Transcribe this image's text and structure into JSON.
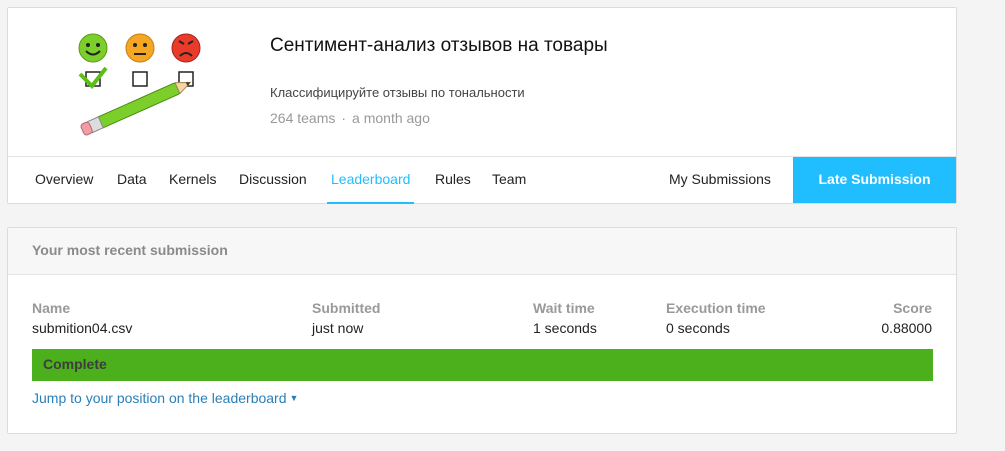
{
  "competition": {
    "title": "Сентимент-анализ отзывов на товары",
    "subtitle": "Классифицируйте отзывы по тональности",
    "teams": "264 teams",
    "separator": "·",
    "age": "a month ago"
  },
  "tabs": [
    {
      "label": "Overview",
      "active": false
    },
    {
      "label": "Data",
      "active": false
    },
    {
      "label": "Kernels",
      "active": false
    },
    {
      "label": "Discussion",
      "active": false
    },
    {
      "label": "Leaderboard",
      "active": true
    },
    {
      "label": "Rules",
      "active": false
    },
    {
      "label": "Team",
      "active": false
    }
  ],
  "my_submissions_label": "My Submissions",
  "late_submission_label": "Late Submission",
  "submission": {
    "heading": "Your most recent submission",
    "columns": {
      "name": {
        "header": "Name",
        "value": "submition04.csv"
      },
      "submitted": {
        "header": "Submitted",
        "value": "just now"
      },
      "wait": {
        "header": "Wait time",
        "value": "1 seconds"
      },
      "execution": {
        "header": "Execution time",
        "value": "0 seconds"
      },
      "score": {
        "header": "Score",
        "value": "0.88000"
      }
    },
    "status": "Complete",
    "jump_link": "Jump to your position on the leaderboard"
  },
  "colors": {
    "accent": "#20beff",
    "status_complete": "#4caf1c",
    "link": "#2a7fb8"
  },
  "icons": [
    "happy-face-icon",
    "neutral-face-icon",
    "angry-face-icon",
    "checkbox-icon",
    "pencil-icon",
    "caret-down-icon"
  ]
}
